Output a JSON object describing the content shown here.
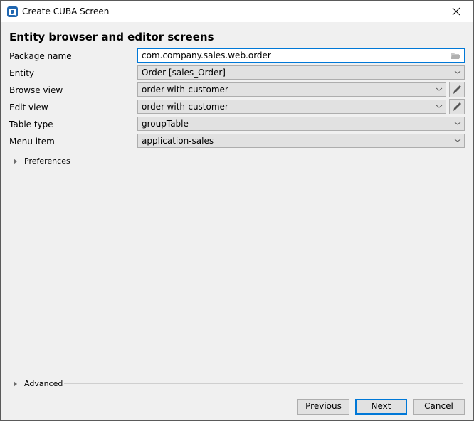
{
  "window": {
    "title": "Create CUBA Screen",
    "close_icon": "close-icon",
    "app_icon": "cuba-app-icon"
  },
  "heading": "Entity browser and editor screens",
  "form": {
    "package_name": {
      "label": "Package name",
      "value": "com.company.sales.web.order",
      "icon": "folder-open-icon"
    },
    "entity": {
      "label": "Entity",
      "value": "Order [sales_Order]"
    },
    "browse_view": {
      "label": "Browse view",
      "value": "order-with-customer",
      "edit_icon": "pencil-icon"
    },
    "edit_view": {
      "label": "Edit view",
      "value": "order-with-customer",
      "edit_icon": "pencil-icon"
    },
    "table_type": {
      "label": "Table type",
      "value": "groupTable"
    },
    "menu_item": {
      "label": "Menu item",
      "value": "application-sales"
    }
  },
  "sections": {
    "preferences": "Preferences",
    "advanced": "Advanced"
  },
  "buttons": {
    "previous": {
      "mnemonic": "P",
      "rest": "revious"
    },
    "next": {
      "mnemonic": "N",
      "rest": "ext"
    },
    "cancel": "Cancel"
  }
}
